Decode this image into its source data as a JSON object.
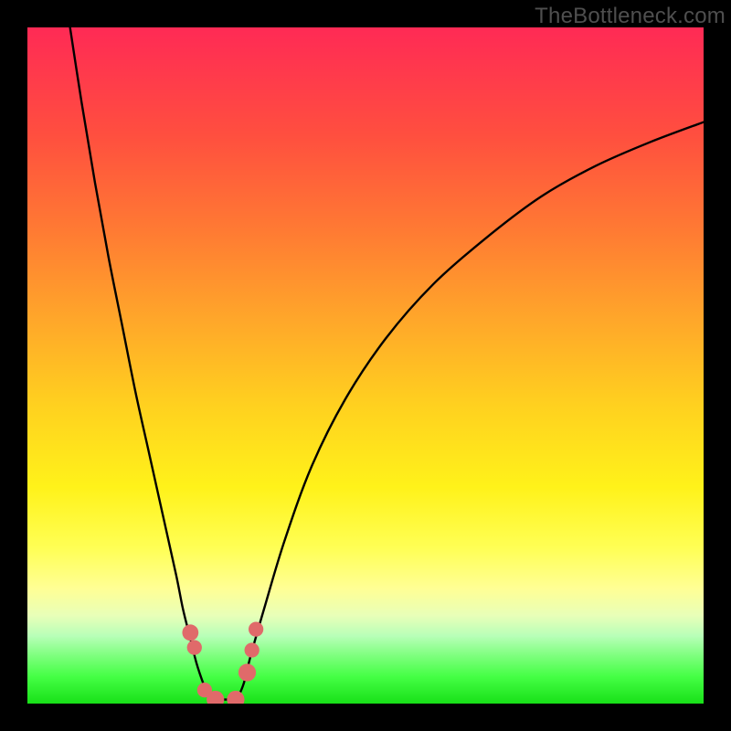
{
  "watermark": "TheBottleneck.com",
  "colors": {
    "curve_stroke": "#000000",
    "marker_fill": "#e06a6a",
    "gradient_top": "#ff2a55",
    "gradient_bottom": "#18e018"
  },
  "chart_data": {
    "type": "line",
    "title": "",
    "xlabel": "",
    "ylabel": "",
    "xlim": [
      0,
      100
    ],
    "ylim": [
      0,
      100
    ],
    "grid": false,
    "legend": false,
    "series": [
      {
        "name": "left_branch",
        "x": [
          6,
          8,
          10,
          12,
          14,
          16,
          18,
          20,
          22,
          23,
          24,
          25,
          26,
          27
        ],
        "y": [
          102,
          89,
          77,
          66,
          56,
          46,
          37,
          28,
          19,
          14,
          10,
          6,
          3,
          0.6
        ]
      },
      {
        "name": "right_branch",
        "x": [
          31,
          32,
          33,
          35,
          38,
          42,
          47,
          53,
          60,
          68,
          76,
          84,
          92,
          100
        ],
        "y": [
          0.6,
          3,
          7,
          14,
          24,
          35,
          45,
          54,
          62,
          69,
          75,
          79.5,
          83,
          86
        ]
      },
      {
        "name": "flat_segment",
        "x": [
          27,
          31
        ],
        "y": [
          0.6,
          0.6
        ]
      }
    ],
    "markers": [
      {
        "x": 24.1,
        "y": 10.5,
        "r": 1.2
      },
      {
        "x": 24.7,
        "y": 8.3,
        "r": 1.1
      },
      {
        "x": 26.2,
        "y": 2.0,
        "r": 1.1
      },
      {
        "x": 27.8,
        "y": 0.6,
        "r": 1.3
      },
      {
        "x": 30.8,
        "y": 0.6,
        "r": 1.3
      },
      {
        "x": 32.5,
        "y": 4.6,
        "r": 1.3
      },
      {
        "x": 33.2,
        "y": 7.9,
        "r": 1.1
      },
      {
        "x": 33.8,
        "y": 11.0,
        "r": 1.1
      }
    ]
  }
}
